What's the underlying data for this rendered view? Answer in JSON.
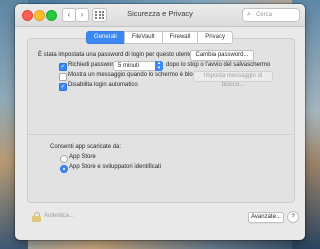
{
  "window": {
    "title": "Sicurezza e Privacy",
    "search_placeholder": "Cerca",
    "nav_back_glyph": "‹",
    "nav_forward_glyph": "›"
  },
  "tabs": [
    {
      "label": "Generali",
      "active": true
    },
    {
      "label": "FileVault",
      "active": false
    },
    {
      "label": "Firewall",
      "active": false
    },
    {
      "label": "Privacy",
      "active": false
    }
  ],
  "general": {
    "password_set_text": "È stata impostata una password di login per questo utente",
    "change_password_button": "Cambia password...",
    "require_password": {
      "checked": true,
      "label": "Richiedi password",
      "select_value": "5 minuti",
      "suffix": "dopo lo stop o l'avvio del salvaschermo"
    },
    "show_message": {
      "checked": false,
      "label": "Mostra un messaggio quando lo schermo è bloccato",
      "button": "Imposta messaggio di blocco..."
    },
    "disable_auto_login": {
      "checked": true,
      "label": "Disabilita login automatico"
    }
  },
  "downloads": {
    "heading": "Consenti app scaricate da:",
    "options": [
      {
        "label": "App Store",
        "selected": false
      },
      {
        "label": "App Store e sviluppatori identificati",
        "selected": true
      }
    ]
  },
  "footer": {
    "lock_label": "Autentica...",
    "advanced_button": "Avanzate...",
    "help_glyph": "?"
  },
  "colors": {
    "accent": "#3b87f3",
    "close": "#ff5f57",
    "minimize": "#febc2e",
    "maximize": "#28c840"
  }
}
